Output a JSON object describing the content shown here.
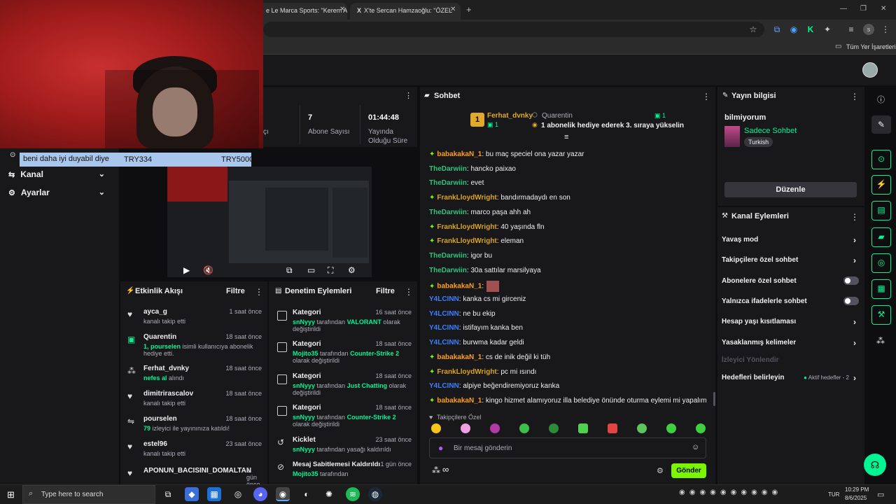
{
  "browser": {
    "tabs": [
      {
        "title": "e Le Marca Sports: \"Kerem A"
      },
      {
        "title": "X'te Sercan Hamzaoğlu: \"ÖZEL"
      }
    ],
    "bookmarks_label": "Tüm Yer İşaretleri"
  },
  "overlay": {
    "donation_text": "beni daha iyi duyabil diye",
    "donation_amount1": "TRY334",
    "donation_amount2": "TRY5000"
  },
  "left_nav": {
    "items": [
      {
        "label": "Kanal"
      },
      {
        "label": "Ayarlar"
      }
    ]
  },
  "stats": {
    "partial_label": "çı",
    "subs_value": "7",
    "subs_label": "Abone Sayısı",
    "uptime_value": "01:44:48",
    "uptime_label_line1": "Yayında",
    "uptime_label_line2": "Olduğu Süre"
  },
  "activity": {
    "title": "Etkinlik Akışı",
    "filter": "Filtre",
    "items": [
      {
        "name": "ayca_g",
        "time": "1 saat önce",
        "sub": "kanalı takip etti",
        "icon": "heart-icon"
      },
      {
        "name": "Quarentin",
        "time": "18 saat önce",
        "sub_green": "1, pourselen",
        "sub": " isimli kullanıcıya abonelik hediye etti.",
        "icon": "gift-icon"
      },
      {
        "name": "Ferhat_dvnky",
        "time": "18 saat önce",
        "sub_green": "nefes al",
        "sub": " alındı",
        "icon": "points-icon"
      },
      {
        "name": "dimitrirascalov",
        "time": "18 saat önce",
        "sub": "kanalı takip etti",
        "icon": "heart-icon"
      },
      {
        "name": "pourselen",
        "time": "18 saat önce",
        "sub_green": "79",
        "sub": " izleyici ile yayınınıza katıldı!",
        "icon": "raid-icon"
      },
      {
        "name": "estel96",
        "time": "23 saat önce",
        "sub": "kanalı takip etti",
        "icon": "heart-icon"
      },
      {
        "name": "APONUN_BACISINI_DOMALTAN",
        "time": "1 gün önce",
        "sub": "",
        "icon": "heart-icon"
      }
    ]
  },
  "mod": {
    "title": "Denetim Eylemleri",
    "filter": "Filtre",
    "items": [
      {
        "title": "Kategori",
        "time": "16 saat önce",
        "actor": "snNyyy",
        "mid": " tarafından ",
        "target": "VALORANT",
        "end": " olarak değiştirildi"
      },
      {
        "title": "Kategori",
        "time": "18 saat önce",
        "actor": "Mojito35",
        "mid": " tarafından ",
        "target": "Counter-Strike 2",
        "end": " olarak değiştirildi"
      },
      {
        "title": "Kategori",
        "time": "18 saat önce",
        "actor": "snNyyy",
        "mid": " tarafından ",
        "target": "Just Chatting",
        "end": " olarak değiştirildi"
      },
      {
        "title": "Kategori",
        "time": "18 saat önce",
        "actor": "snNyyy",
        "mid": " tarafından ",
        "target": "Counter-Strike 2",
        "end": " olarak değiştirildi"
      },
      {
        "title": "Kicklet",
        "time": "23 saat önce",
        "actor": "snNyyy",
        "mid": " tarafından yasağı kaldırıldı",
        "target": "",
        "end": ""
      },
      {
        "title": "Mesaj Sabitlemesi Kaldırıldı",
        "time": "1 gün önce",
        "actor": "Mojito35",
        "mid": " tarafından",
        "target": "",
        "end": ""
      }
    ]
  },
  "chat": {
    "title": "Sohbet",
    "gifter_name": "Ferhat_dvnky",
    "gifter_count": "1",
    "gifted_name": "Quarentin",
    "gifted_count": "1",
    "gift_text": "1 abonelik hediye ederek 3. sıraya yükselin",
    "messages": [
      {
        "user": "babakakaN_1",
        "color": "orange",
        "badge": true,
        "text": ": bu maç speciel ona yazar yazar"
      },
      {
        "user": "TheDarwiin",
        "color": "green",
        "badge": false,
        "text": ": hancko paixao"
      },
      {
        "user": "TheDarwiin",
        "color": "green",
        "badge": false,
        "text": ": evet"
      },
      {
        "user": "FrankLloydWright",
        "color": "gold",
        "badge": true,
        "text": ": bandırmadaydı en son"
      },
      {
        "user": "TheDarwiin",
        "color": "green",
        "badge": false,
        "text": ": marco paşa ahh ah"
      },
      {
        "user": "FrankLloydWright",
        "color": "gold",
        "badge": true,
        "text": ": 40 yaşında fln"
      },
      {
        "user": "FrankLloydWright",
        "color": "gold",
        "badge": true,
        "text": ": eleman"
      },
      {
        "user": "TheDarwiin",
        "color": "green",
        "badge": false,
        "text": ": igor bu"
      },
      {
        "user": "TheDarwiin",
        "color": "green",
        "badge": false,
        "text": ": 30a sattılar marsilyaya"
      },
      {
        "user": "babakakaN_1",
        "color": "orange",
        "badge": true,
        "text": ":"
      },
      {
        "user": "Y4LCINN",
        "color": "blue",
        "badge": false,
        "text": ": kanka cs mi girceniz"
      },
      {
        "user": "Y4LCINN",
        "color": "blue",
        "badge": false,
        "text": ": ne bu ekip"
      },
      {
        "user": "Y4LCINN",
        "color": "blue",
        "badge": false,
        "text": ": istifayım kanka ben"
      },
      {
        "user": "Y4LCINN",
        "color": "blue",
        "badge": false,
        "text": ": burwma kadar geldi"
      },
      {
        "user": "babakakaN_1",
        "color": "orange",
        "badge": true,
        "text": ": cs de inik değil ki tüh"
      },
      {
        "user": "FrankLloydWright",
        "color": "gold",
        "badge": true,
        "text": ": pc mi ısındı"
      },
      {
        "user": "Y4LCINN",
        "color": "blue",
        "badge": false,
        "text": ": alpiye beğendiremiyoruz kanka"
      },
      {
        "user": "babakakaN_1",
        "color": "orange",
        "badge": true,
        "text": ": kingo hizmet alamıyoruz illa belediye önünde oturma eylemi mi yapalım"
      }
    ],
    "emote_section": "Takipçilere Özel",
    "input_placeholder": "Bir mesaj gönderin",
    "send_label": "Gönder",
    "infinity": "∞"
  },
  "stream_info": {
    "title": "Yayın bilgisi",
    "stream_title": "bilmiyorum",
    "category": "Sadece Sohbet",
    "tag": "Turkish",
    "edit_label": "Düzenle"
  },
  "channel_actions": {
    "title": "Kanal Eylemleri",
    "items": [
      {
        "label": "Yavaş mod",
        "control": "chevron"
      },
      {
        "label": "Takipçilere özel sohbet",
        "control": "chevron"
      },
      {
        "label": "Abonelere özel sohbet",
        "control": "toggle"
      },
      {
        "label": "Yalnızca ifadelerle sohbet",
        "control": "toggle"
      },
      {
        "label": "Hesap yaşı kısıtlaması",
        "control": "chevron"
      },
      {
        "label": "Yasaklanmış kelimeler",
        "control": "chevron"
      }
    ],
    "disabled_label": "İzleyici Yönlendir",
    "goals_label": "Hedefleri belirleyin",
    "goals_status": "Aktif hedefler - 2"
  },
  "taskbar": {
    "search_placeholder": "Type here to search",
    "language": "TUR",
    "time": "10:29 PM",
    "date": "8/6/2025"
  },
  "colors": {
    "accent": "#00f593",
    "send": "#7cf500",
    "panel": "#18181b",
    "background": "#0e0e10"
  }
}
